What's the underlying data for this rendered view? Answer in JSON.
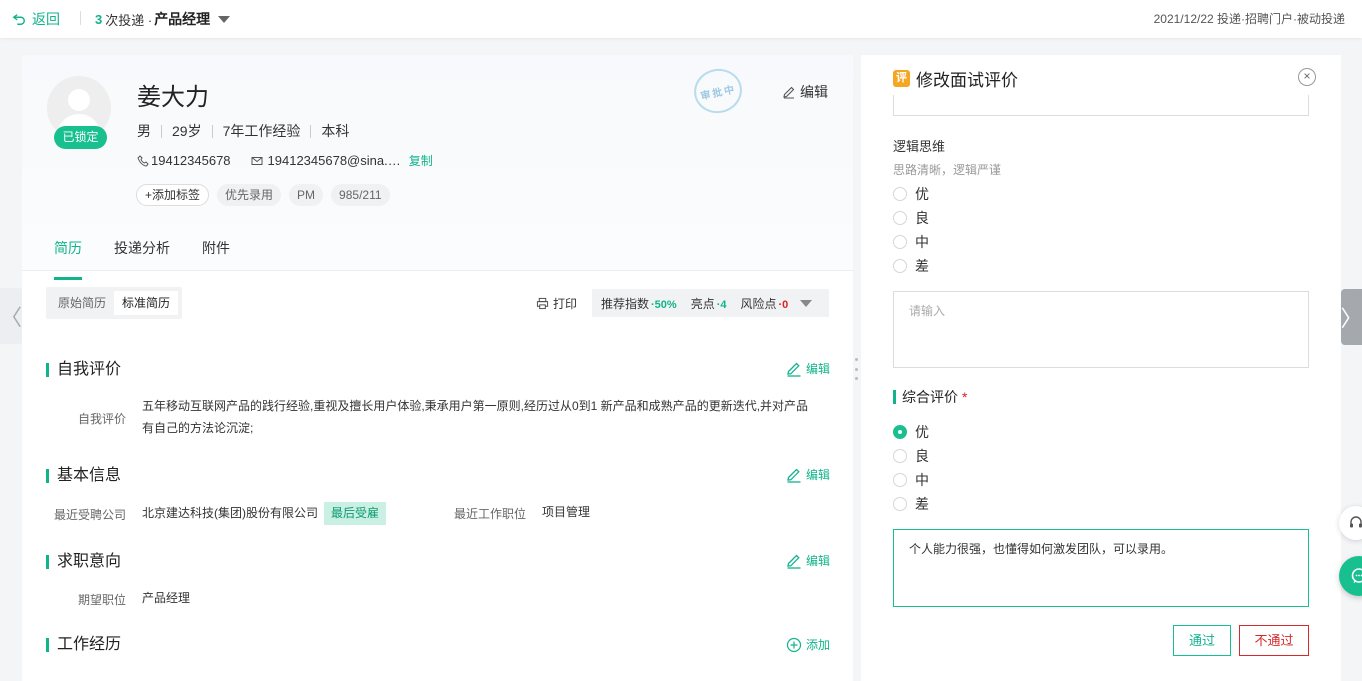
{
  "topbar": {
    "back_label": "返回",
    "delivery_count": "3",
    "delivery_text": "次投递 · ",
    "position": "产品经理",
    "meta": "2021/12/22 投递·招聘门户·被动投递"
  },
  "candidate": {
    "locked_label": "已锁定",
    "name": "姜大力",
    "gender": "男",
    "age": "29岁",
    "experience": "7年工作经验",
    "education": "本科",
    "phone": "19412345678",
    "email": "19412345678@sina.…",
    "copy_label": "复制",
    "add_tag_label": "添加标签",
    "tags": [
      "优先录用",
      "PM",
      "985/211"
    ],
    "stamp_text": "审批中",
    "edit_label": "编辑"
  },
  "tabs": [
    {
      "label": "简历",
      "active": true
    },
    {
      "label": "投递分析",
      "active": false
    },
    {
      "label": "附件",
      "active": false
    }
  ],
  "resume_toolbar": {
    "original_label": "原始简历",
    "standard_label": "标准简历",
    "print_label": "打印",
    "recommend_label": "推荐指数",
    "recommend_value": "·50%",
    "highlight_label": "亮点",
    "highlight_value": "·4",
    "risk_label": "风险点",
    "risk_value": "·0"
  },
  "sections": {
    "self_eval": {
      "title": "自我评价",
      "edit_label": "编辑",
      "field_label": "自我评价",
      "text_line1": "五年移动互联网产品的践行经验,重视及擅长用户体验,秉承用户第一原则,经历过从0到1 新产品和成熟产品的更新迭代,并对产品",
      "text_line2": "有自己的方法论沉淀;"
    },
    "basic_info": {
      "title": "基本信息",
      "edit_label": "编辑",
      "company_label": "最近受聘公司",
      "company_value": "北京建达科技(集团)股份有限公司",
      "company_badge": "最后受雇",
      "job_label": "最近工作职位",
      "job_value": "项目管理"
    },
    "intent": {
      "title": "求职意向",
      "edit_label": "编辑",
      "position_label": "期望职位",
      "position_value": "产品经理"
    },
    "work": {
      "title": "工作经历",
      "add_label": "添加"
    }
  },
  "panel": {
    "title": "修改面试评价",
    "logic": {
      "title": "逻辑思维",
      "subtitle": "思路清晰，逻辑严谨",
      "options": [
        "优",
        "良",
        "中",
        "差"
      ],
      "selected": null,
      "placeholder": "请输入"
    },
    "overall": {
      "title": "综合评价",
      "required_mark": "*",
      "options": [
        "优",
        "良",
        "中",
        "差"
      ],
      "selected": "优",
      "comment": "个人能力很强，也懂得如何激发团队，可以录用。"
    },
    "pass_label": "通过",
    "fail_label": "不通过"
  },
  "colors": {
    "accent": "#11b38b",
    "danger": "#d62929",
    "badge_bg": "#c9f0e2"
  }
}
